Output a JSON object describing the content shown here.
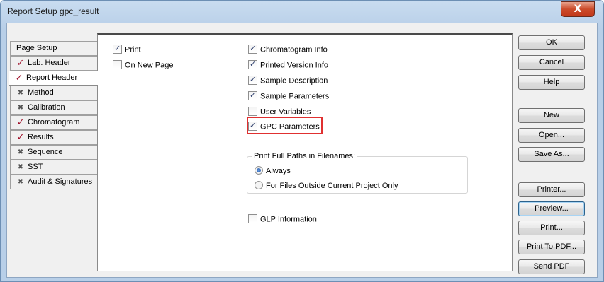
{
  "window": {
    "title": "Report Setup gpc_result",
    "close_glyph": "X"
  },
  "tabs": [
    {
      "label": "Page Setup",
      "glyph": "",
      "state": "plain"
    },
    {
      "label": "Lab. Header",
      "glyph": "✓",
      "state": "checked"
    },
    {
      "label": "Report Header",
      "glyph": "✓",
      "state": "checked-selected"
    },
    {
      "label": "Method",
      "glyph": "✖",
      "state": "crossed"
    },
    {
      "label": "Calibration",
      "glyph": "✖",
      "state": "crossed"
    },
    {
      "label": "Chromatogram",
      "glyph": "✓",
      "state": "checked"
    },
    {
      "label": "Results",
      "glyph": "✓",
      "state": "checked"
    },
    {
      "label": "Sequence",
      "glyph": "✖",
      "state": "crossed"
    },
    {
      "label": "SST",
      "glyph": "✖",
      "state": "crossed"
    },
    {
      "label": "Audit & Signatures",
      "glyph": "✖",
      "state": "crossed"
    }
  ],
  "options": {
    "print": {
      "label": "Print",
      "checked": true
    },
    "on_new_page": {
      "label": "On New Page",
      "checked": false
    },
    "chromatogram_info": {
      "label": "Chromatogram Info",
      "checked": true
    },
    "printed_version_info": {
      "label": "Printed Version Info",
      "checked": true
    },
    "sample_description": {
      "label": "Sample Description",
      "checked": true
    },
    "sample_parameters": {
      "label": "Sample Parameters",
      "checked": true
    },
    "user_variables": {
      "label": "User Variables",
      "checked": false
    },
    "gpc_parameters": {
      "label": "GPC Parameters",
      "checked": true
    },
    "glp_information": {
      "label": "GLP Information",
      "checked": false
    }
  },
  "paths_group": {
    "title": "Print Full Paths in Filenames:",
    "always": {
      "label": "Always",
      "selected": true
    },
    "outside": {
      "label": "For Files Outside Current Project Only",
      "selected": false
    }
  },
  "buttons": {
    "ok": "OK",
    "cancel": "Cancel",
    "help": "Help",
    "new": "New",
    "open": "Open...",
    "save_as": "Save As...",
    "printer": "Printer...",
    "preview": "Preview...",
    "print": "Print...",
    "print_to_pdf": "Print To PDF...",
    "send_pdf": "Send PDF"
  },
  "colors": {
    "highlight": "#e03030",
    "check_mark": "#a0102a",
    "title_bar": "#b8cfe8"
  },
  "icons": {
    "checked_tab": "check-icon",
    "crossed_tab": "cross-icon",
    "close": "close-icon"
  }
}
